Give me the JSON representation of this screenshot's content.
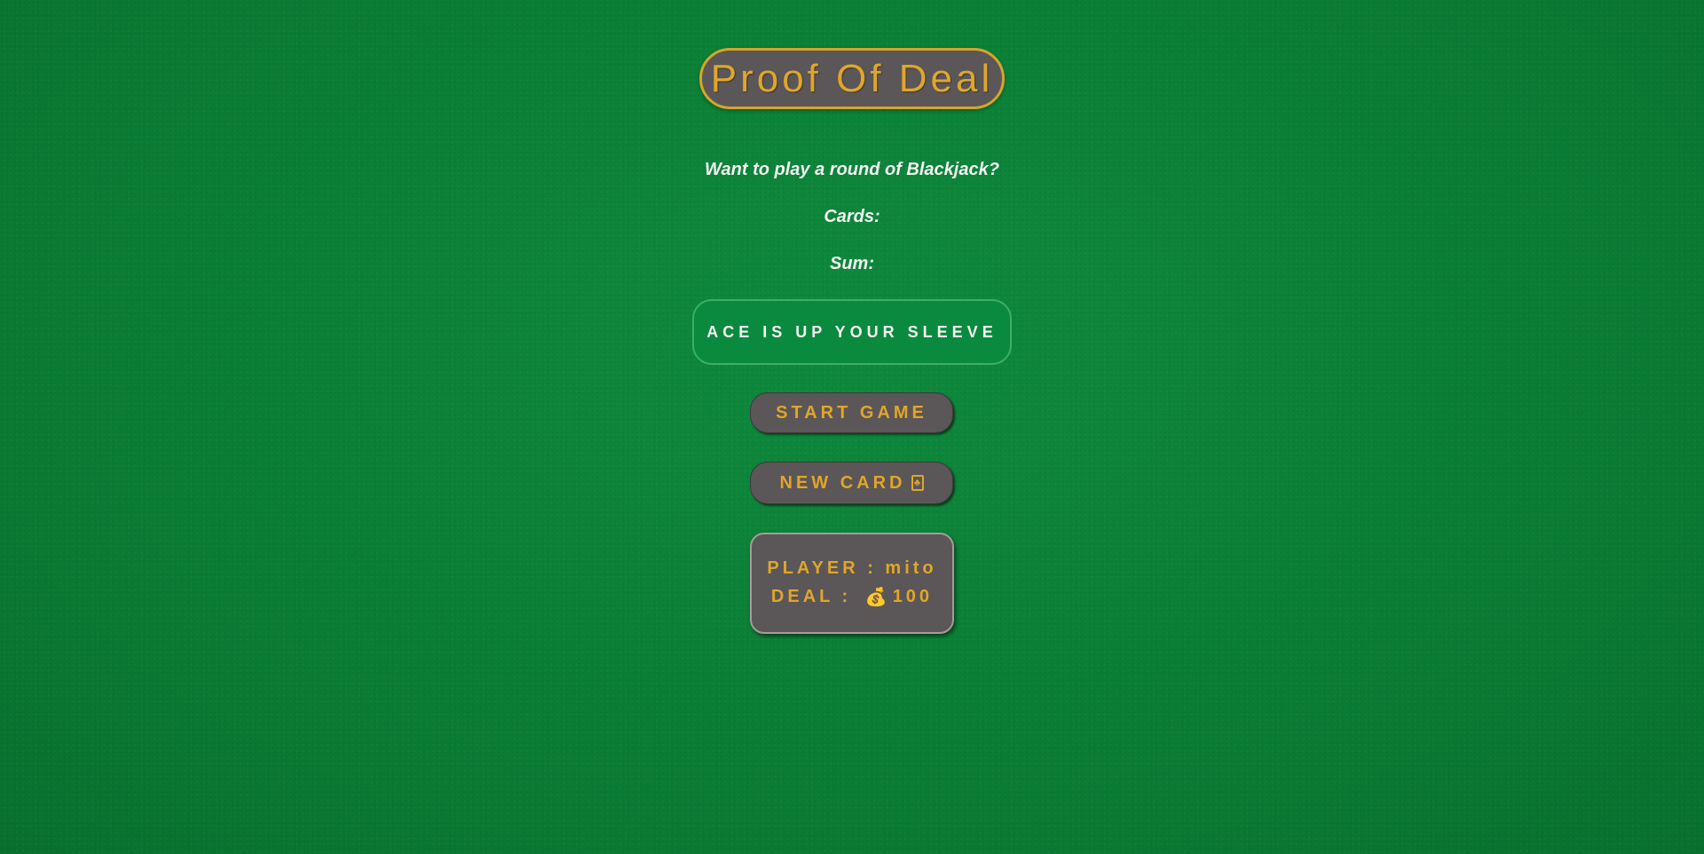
{
  "header": {
    "title": "Proof Of Deal"
  },
  "game": {
    "message": "Want to play a round of Blackjack?",
    "cards_label": "Cards:",
    "sum_label": "Sum:",
    "sleeve_text": "ACE IS UP YOUR SLEEVE"
  },
  "controls": {
    "start_label": "START GAME",
    "new_card_label": "NEW CARD",
    "new_card_icon": "playing-card-icon"
  },
  "player": {
    "player_label": "PLAYER : ",
    "player_name": "mito",
    "deal_label": "DEAL : ",
    "deal_icon": "money-bag-icon",
    "deal_amount": "100"
  },
  "colors": {
    "felt_green": "#0c8438",
    "panel_gray": "#5b5657",
    "gold": "#e0a62b",
    "sleeve_green": "#0a8a3e"
  }
}
